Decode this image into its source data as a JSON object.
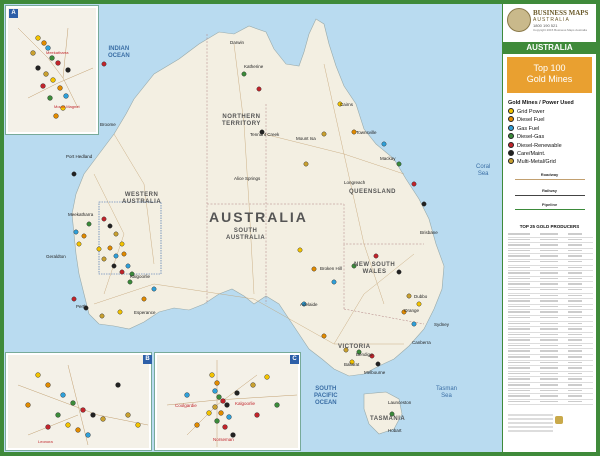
{
  "brand": {
    "name": "BUSINESS MAPS",
    "subname": "AUSTRALIA",
    "phone": "1800 190 521",
    "copyright": "Copyright 2015 Business Maps Australia"
  },
  "title": "AUSTRALIA",
  "subtitle_line1": "Top 100",
  "subtitle_line2": "Gold Mines",
  "legend": {
    "title": "Gold Mines / Power Used",
    "items": [
      {
        "label": "Grid Power",
        "color": "#f2c200"
      },
      {
        "label": "Diesel Fuel",
        "color": "#e08a00"
      },
      {
        "label": "Gas Fuel",
        "color": "#2f9fd8"
      },
      {
        "label": "Diesel-Gas",
        "color": "#3b8a3a"
      },
      {
        "label": "Diesel-Renewable",
        "color": "#c0242b"
      },
      {
        "label": "Care/Maint.",
        "color": "#222222"
      },
      {
        "label": "Multi-Metal/Grid",
        "color": "#c8a030"
      }
    ],
    "roadway": "Roadway",
    "railway": "Railway",
    "pipeline": "Pipeline"
  },
  "top25_title": "TOP 25 GOLD PRODUCERS",
  "map": {
    "main_label": "AUSTRALIA",
    "oceans": {
      "indian": "INDIAN\nOCEAN",
      "south_pacific": "SOUTH\nPACIFIC\nOCEAN",
      "coral": "Coral\nSea",
      "tasman": "Tasman\nSea"
    },
    "states": {
      "nt": "NORTHERN\nTERRITORY",
      "wa": "WESTERN\nAUSTRALIA",
      "sa": "SOUTH\nAUSTRALIA",
      "qld": "QUEENSLAND",
      "nsw": "NEW SOUTH\nWALES",
      "vic": "VICTORIA",
      "tas": "TASMANIA"
    },
    "cities": {
      "darwin": "Darwin",
      "perth": "Perth",
      "adelaide": "Adelaide",
      "melbourne": "Melbourne",
      "sydney": "Sydney",
      "brisbane": "Brisbane",
      "canberra": "Canberra",
      "hobart": "Hobart",
      "cairns": "Cairns",
      "townsville": "Townsville",
      "mackay": "Mackay",
      "alice_springs": "Alice Springs",
      "kalgoorlie": "Kalgoorlie",
      "mount_isa": "Mount Isa",
      "broome": "Broome",
      "port_hedland": "Port Hedland",
      "katherine": "Katherine",
      "tennant_creek": "Tennant Creek",
      "geraldton": "Geraldton",
      "esperance": "Esperance",
      "longreach": "Longreach",
      "dubbo": "Dubbo",
      "orange": "Orange",
      "broken_hill": "Broken Hill",
      "bendigo": "Bendigo",
      "ballarat": "Ballarat",
      "launceston": "Launceston",
      "meekatharra": "Meekatharra"
    },
    "insets": {
      "a": "A",
      "b": "B",
      "c": "C",
      "a_city1": "Meekatharra",
      "a_city2": "Mount Magnet",
      "b_city1": "Leonora",
      "c_city1": "Coolgardie",
      "c_city2": "Kalgoorlie",
      "c_city3": "Norseman"
    }
  }
}
